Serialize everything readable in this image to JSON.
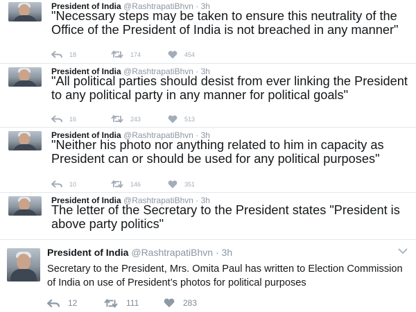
{
  "tweets": [
    {
      "name": "President of India",
      "handle": "@RashtrapatiBhvn",
      "dot": "·",
      "time": "3h",
      "text": "\"Necessary steps may be taken to ensure this neutrality of the Office of the President of India is not breached in any manner\"",
      "replies": "18",
      "retweets": "174",
      "likes": "454"
    },
    {
      "name": "President of India",
      "handle": "@RashtrapatiBhvn",
      "dot": "·",
      "time": "3h",
      "text": "\"All political parties should desist from ever linking the President to any political party in any manner for political goals\"",
      "replies": "16",
      "retweets": "243",
      "likes": "513"
    },
    {
      "name": "President of India",
      "handle": "@RashtrapatiBhvn",
      "dot": "·",
      "time": "3h",
      "text": "\"Neither his photo nor anything related to him in capacity as President can or should be used for any political purposes\"",
      "replies": "10",
      "retweets": "146",
      "likes": "351"
    },
    {
      "name": "President of India",
      "handle": "@RashtrapatiBhvn",
      "dot": "·",
      "time": "3h",
      "text": "The letter of the Secretary to the President states \"President is above party politics\""
    },
    {
      "name": "President of India",
      "handle": "@RashtrapatiBhvn",
      "dot": "·",
      "time": "3h",
      "text": "Secretary to the President, Mrs. Omita Paul has written to Election Commission of India on use of President’s photos for political purposes",
      "replies": "12",
      "retweets": "111",
      "likes": "283"
    }
  ],
  "colors": {
    "text": "#14171a",
    "muted": "#8a96a3",
    "action_icons": "#a3adb8",
    "divider": "#e1e8ed"
  },
  "icons": {
    "reply": "reply-arrow-icon",
    "retweet": "retweet-icon",
    "like": "heart-icon",
    "menu": "chevron-down-icon",
    "avatar": "profile-photo"
  }
}
